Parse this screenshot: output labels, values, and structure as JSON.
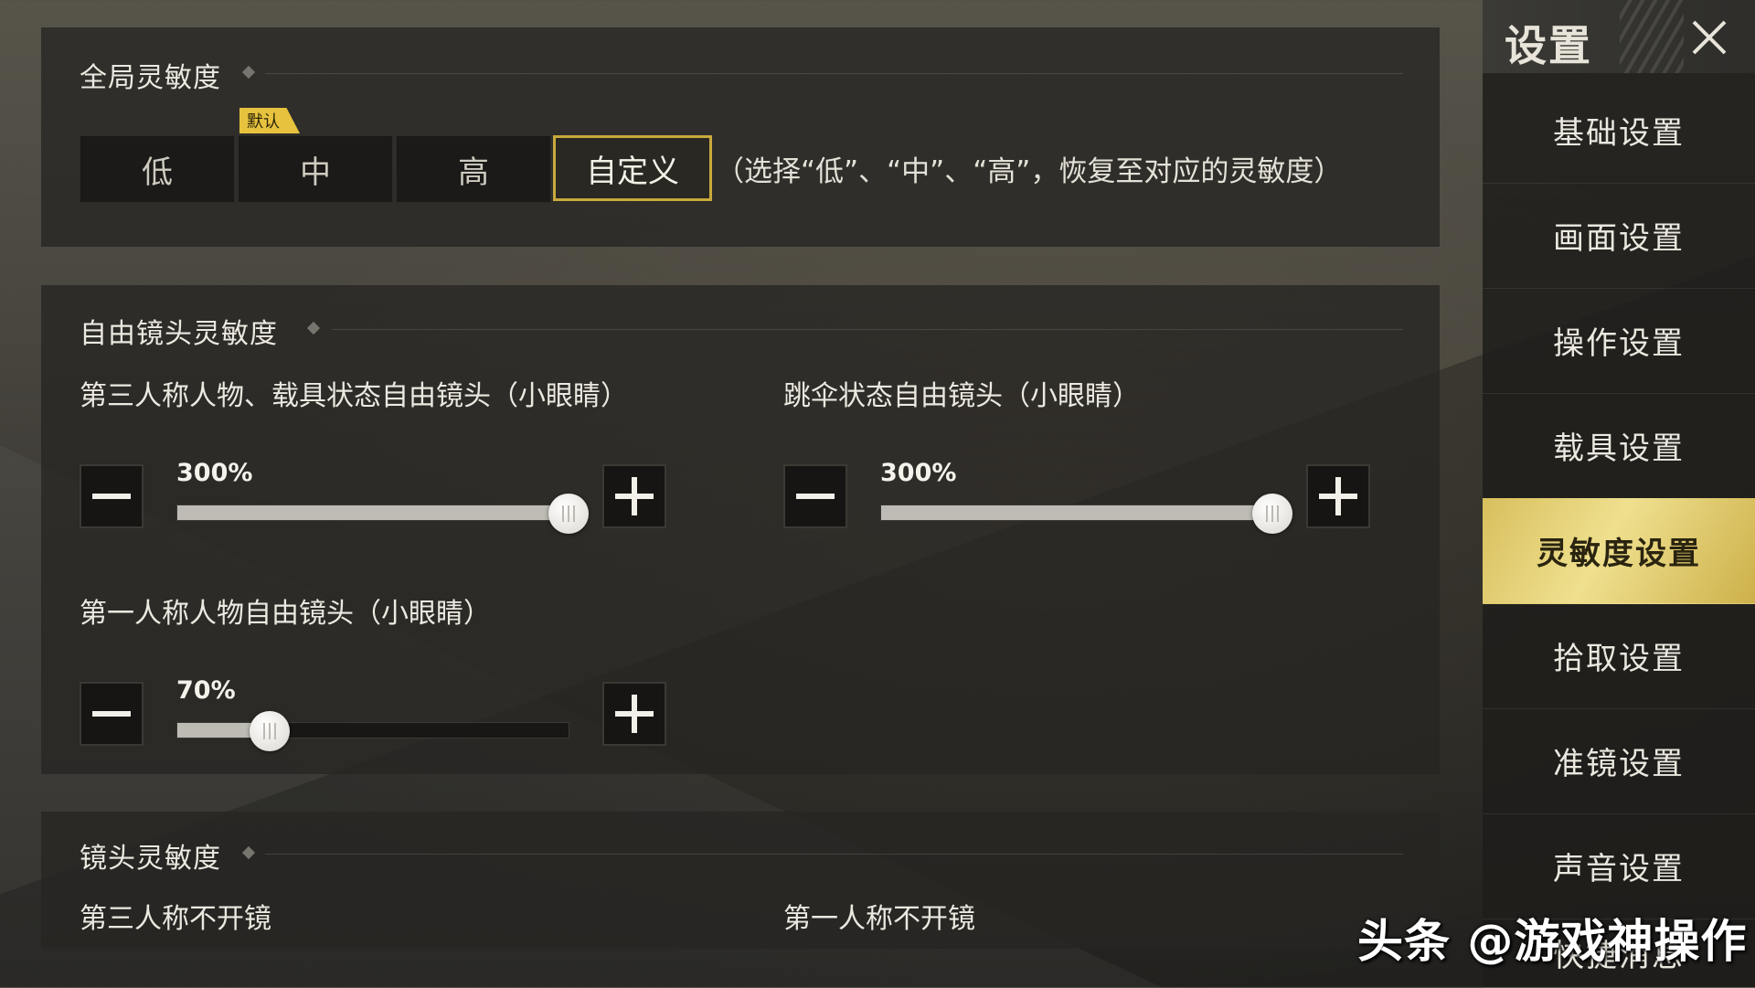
{
  "sidebar": {
    "title": "设置",
    "items": [
      {
        "label": "基础设置"
      },
      {
        "label": "画面设置"
      },
      {
        "label": "操作设置"
      },
      {
        "label": "载具设置"
      },
      {
        "label": "灵敏度设置",
        "active": true
      },
      {
        "label": "拾取设置"
      },
      {
        "label": "准镜设置"
      },
      {
        "label": "声音设置"
      },
      {
        "label": "快捷消息"
      }
    ]
  },
  "global": {
    "title": "全局灵敏度",
    "default_tag": "默认",
    "options": [
      "低",
      "中",
      "高",
      "自定义"
    ],
    "selected": "自定义",
    "hint": "（选择“低”、“中”、“高”，恢复至对应的灵敏度）"
  },
  "free_camera": {
    "title": "自由镜头灵敏度",
    "sliders": [
      {
        "label": "第三人称人物、载具状态自由镜头（小眼睛）",
        "value_text": "300%",
        "fraction": 1.0
      },
      {
        "label": "跳伞状态自由镜头（小眼睛）",
        "value_text": "300%",
        "fraction": 1.0
      },
      {
        "label": "第一人称人物自由镜头（小眼睛）",
        "value_text": "70%",
        "fraction": 0.235
      }
    ]
  },
  "camera": {
    "title": "镜头灵敏度",
    "labels": [
      "第三人称不开镜",
      "第一人称不开镜"
    ]
  },
  "watermark": "头条 @游戏神操作",
  "colors": {
    "accent_gold": "#c9a93c",
    "active_tab": "#e7d277"
  },
  "icons": {
    "close": "close-icon",
    "minus": "minus-icon",
    "plus": "plus-icon"
  }
}
